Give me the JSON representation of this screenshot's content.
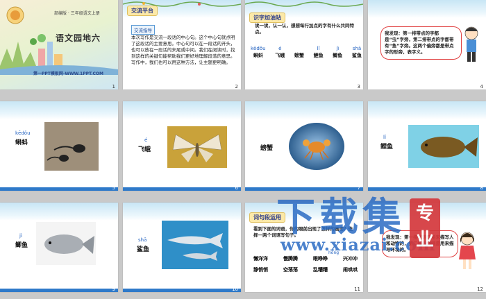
{
  "slides": [
    {
      "num": "1",
      "subtitle": "部编版 · 三年级语文上册",
      "title": "语文园地六",
      "footer": "第一PPT模板网-WWW.1PPT.COM"
    },
    {
      "num": "2",
      "tag": "交流平台",
      "subtag": "交流指导",
      "body": "本次写作是交流一段话的中心句。这个中心句就点明了这段话的主要意思。中心句可以在一段话的开头，也可以放在一段话的末尾或中间。我们在阅读时，找到这样的关键句能帮助我们更好地理解段落的意思。写作中，我们也可以用这种方法，让主题更明确。"
    },
    {
      "num": "3",
      "tag": "识字加油站",
      "intro": "读一读，认一认，想想每行加点的字有什么共同特点。",
      "words": [
        {
          "py": "kēdǒu",
          "w": "蝌蚪"
        },
        {
          "py": "é",
          "w": "飞蛾"
        },
        {
          "py": "",
          "w": "螃蟹"
        },
        {
          "py": "lǐ",
          "w": "鲤鱼"
        },
        {
          "py": "jì",
          "w": "鲫鱼"
        },
        {
          "py": "shā",
          "w": "鲨鱼"
        }
      ]
    },
    {
      "num": "4",
      "bubble": "我发现：第一排带点的字都是“虫”字旁，第二排带点的字都带有“鱼”字旁。这两个偏旁都是带点字的形旁，表字义。"
    },
    {
      "num": "5",
      "py": "kēdǒu",
      "word": "蝌蚪"
    },
    {
      "num": "6",
      "py": "é",
      "word": "飞蛾"
    },
    {
      "num": "7",
      "py": "",
      "word": "螃蟹"
    },
    {
      "num": "8",
      "py": "lǐ",
      "word": "鲤鱼"
    },
    {
      "num": "9",
      "py": "jì",
      "word": "鲫鱼"
    },
    {
      "num": "10",
      "py": "shā",
      "word": "鲨鱼"
    },
    {
      "num": "11",
      "tag": "词句段运用",
      "intro": "看到下面的词语，你的眼前出现了怎样的画面？选择一两个词语写句子。",
      "rows": [
        [
          "懒洋洋",
          "慢腾腾",
          "眼睁睁",
          "兴冲冲"
        ],
        [
          "静悄悄",
          "空荡荡",
          "乱糟糟",
          "闹哄哄"
        ]
      ],
      "dots": "hōng"
    },
    {
      "num": "12",
      "bubble": "我发现：第一排词语是用来描写人和动物的，第二排的叠词是用来描写环境的。"
    }
  ],
  "watermark": {
    "big": "下载集",
    "url": "www.xiazai.com",
    "badge": "专业"
  }
}
